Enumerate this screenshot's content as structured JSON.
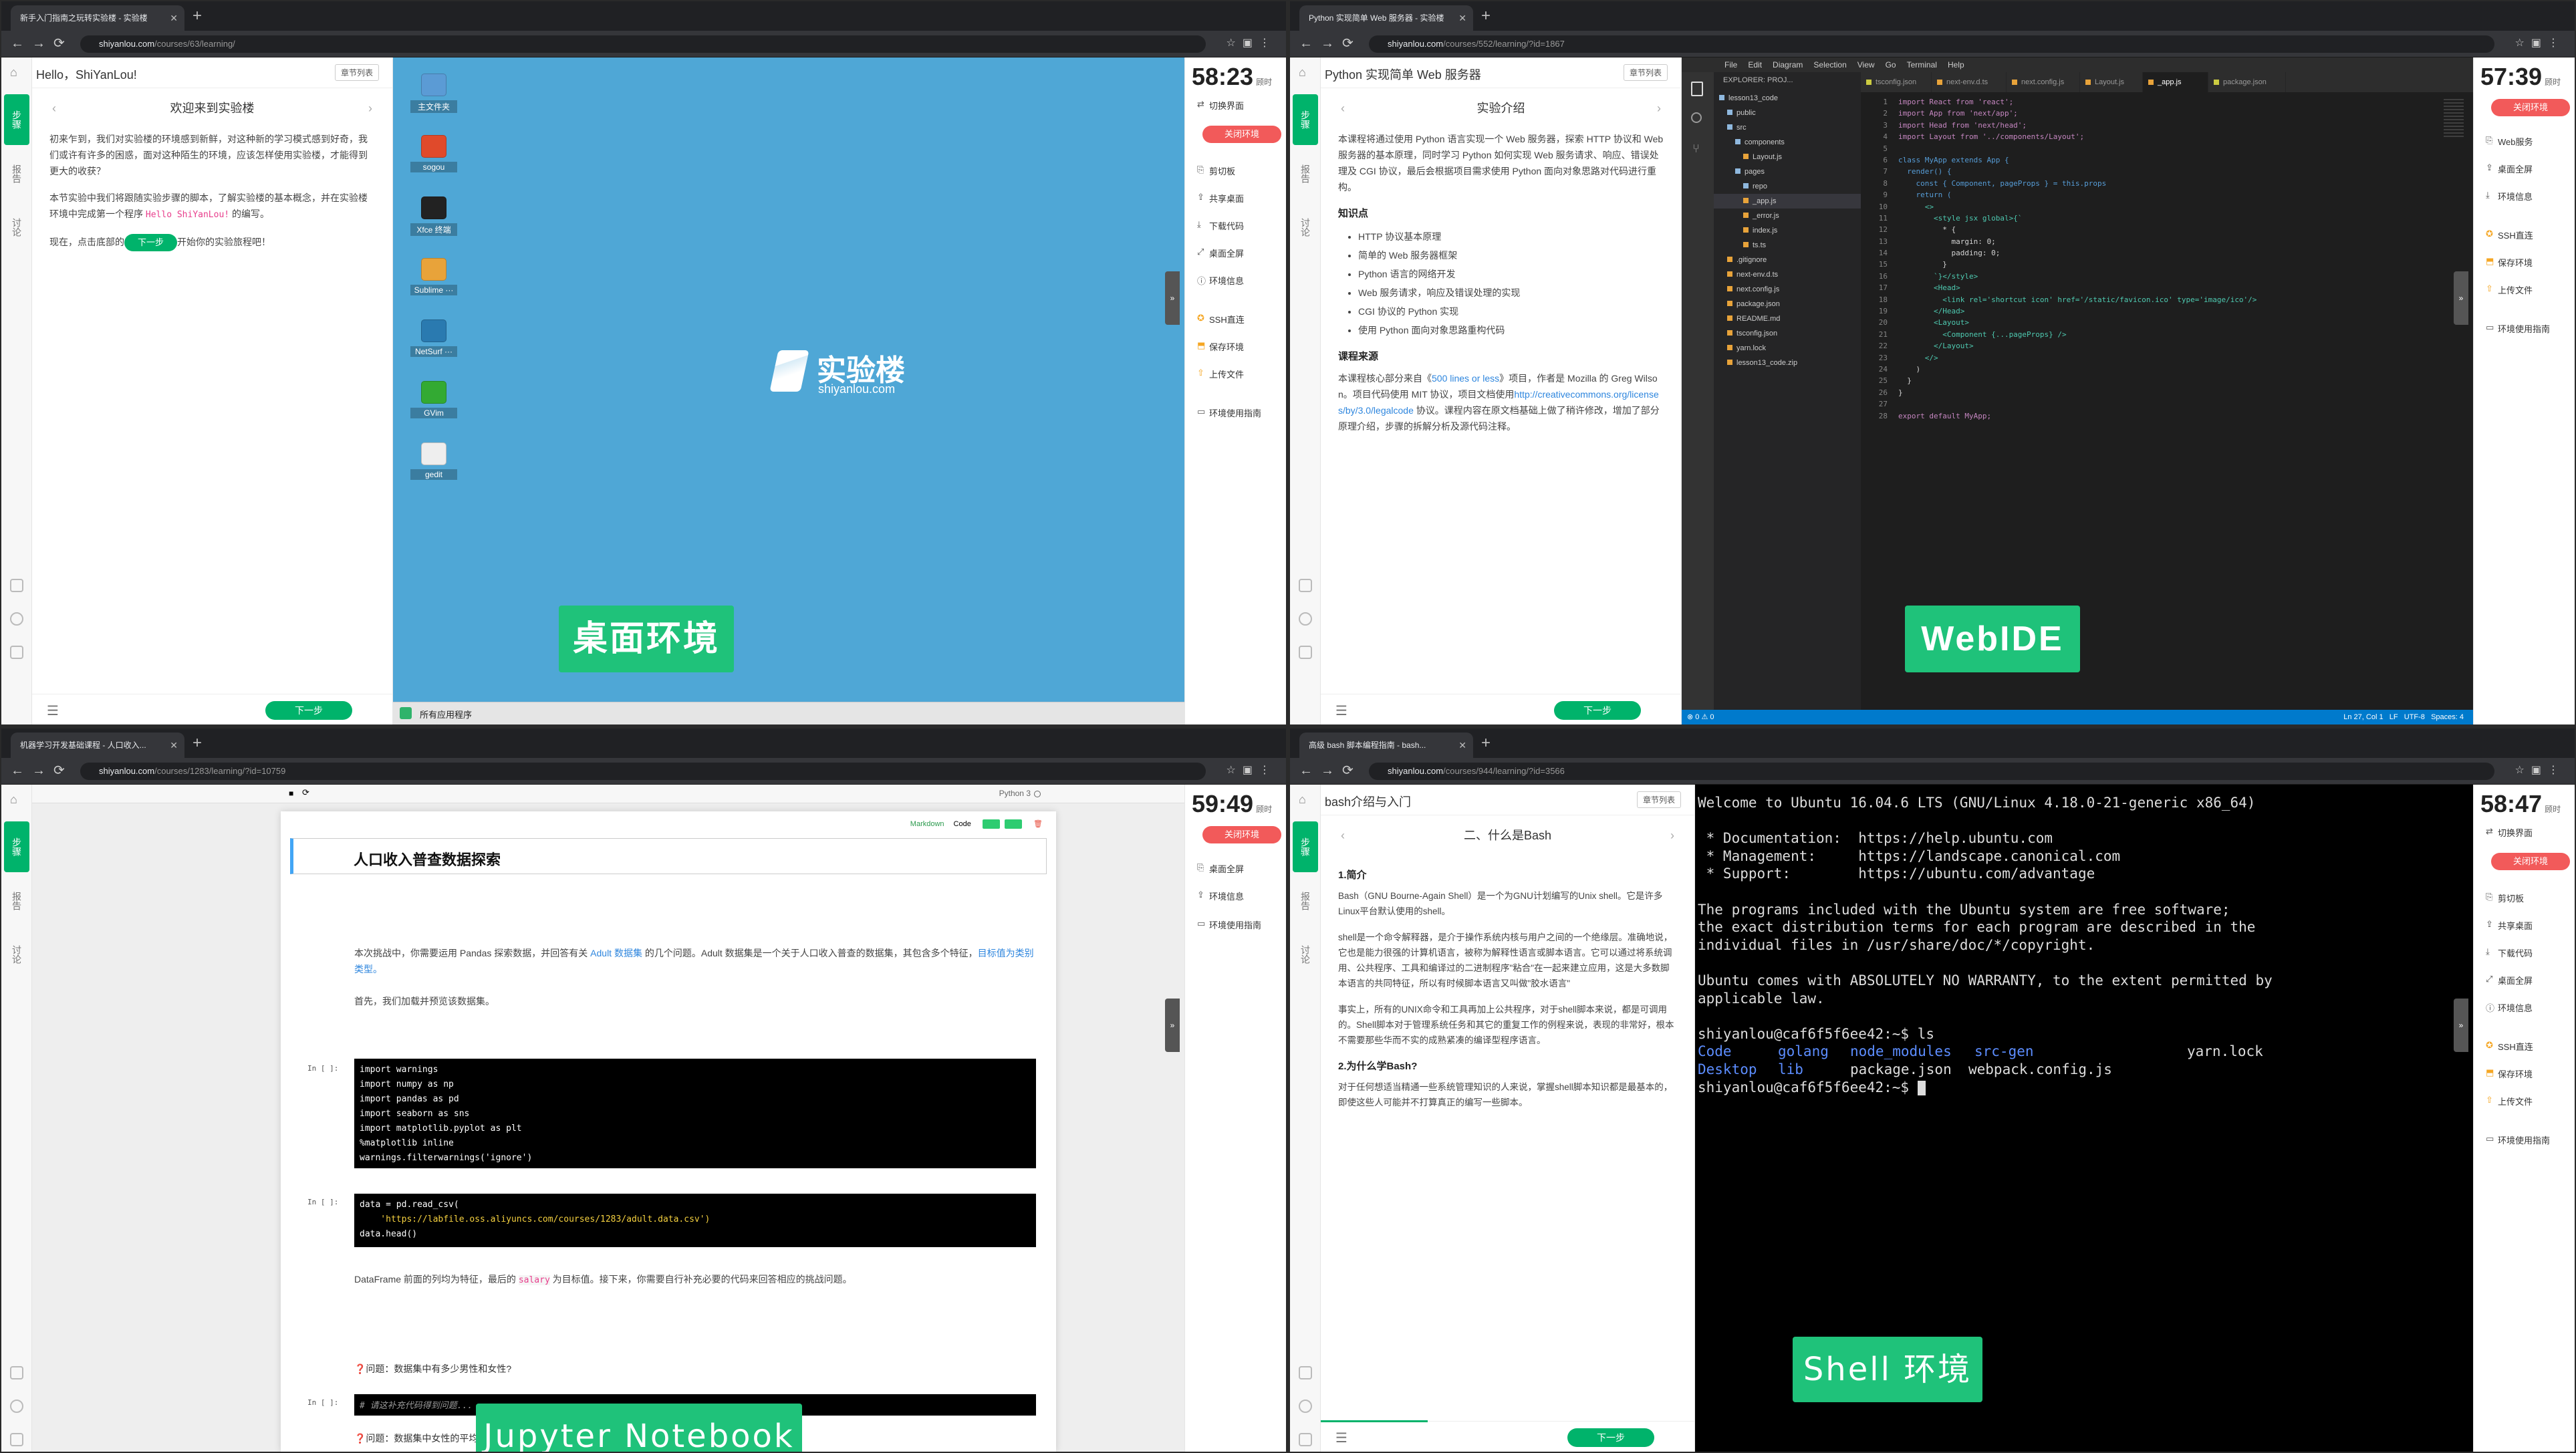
{
  "q1": {
    "tab_title": "新手入门指南之玩转实验楼 - 实验楼",
    "url_domain": "shiyanlou.com",
    "url_path": "/courses/63/learning/",
    "doc_title": "Hello，ShiYanLou!",
    "chapter_btn": "章节列表",
    "sub_title": "欢迎来到实验楼",
    "p1": "初来乍到，我们对实验楼的环境感到新鲜，对这种新的学习模式感到好奇，我们或许有许多的困惑，面对这种陌生的环境，应该怎样使用实验楼，才能得到更大的收获？",
    "p2a": "本节实验中我们将跟随实验步骤的脚本，了解实验楼的基本概念，并在实验楼环境中完成第一个程序 ",
    "p2code": "Hello ShiYanLou!",
    "p2b": " 的编写。",
    "p3a": "现在，点击底部的",
    "p3btn": "下一步",
    "p3b": "开始你的实验旅程吧！",
    "next": "下一步",
    "desktop_icons": [
      "主文件夹",
      "sogou",
      "Xfce 终端",
      "Sublime ···",
      "NetSurf ···",
      "GVim",
      "gedit"
    ],
    "logo_cn": "实验楼",
    "logo_en": "shiyanlou.com",
    "taskbar": "所有应用程序",
    "caption": "桌面环境",
    "timer": "58:23",
    "timer_sub": "顾时",
    "rp_switch": "切换界面",
    "rp_close": "关闭环境",
    "rp_items": [
      "剪切板",
      "共享桌面",
      "下载代码",
      "桌面全屏",
      "环境信息"
    ],
    "rp_items2": [
      "SSH直连",
      "保存环境",
      "上传文件"
    ],
    "rp_guide": "环境使用指南"
  },
  "q2": {
    "tab_title": "Python 实现简单 Web 服务器 - 实验楼",
    "url_domain": "shiyanlou.com",
    "url_path": "/courses/552/learning/?id=1867",
    "doc_title": "Python 实现简单 Web 服务器",
    "chapter_btn": "章节列表",
    "sub_title": "实验介绍",
    "p1": "本课程将通过使用 Python 语言实现一个 Web 服务器，探索 HTTP 协议和 Web 服务器的基本原理，同时学习 Python 如何实现 Web 服务请求、响应、错误处理及 CGI 协议，最后会根据项目需求使用 Python 面向对象思路对代码进行重构。",
    "h_know": "知识点",
    "knowledge": [
      "HTTP 协议基本原理",
      "简单的 Web 服务器框架",
      "Python 语言的网络开发",
      "Web 服务请求，响应及错误处理的实现",
      "CGI 协议的 Python 实现",
      "使用 Python 面向对象思路重构代码"
    ],
    "h_src": "课程来源",
    "src_a": "本课程核心部分来自《",
    "src_link": "500 lines or less",
    "src_b": "》项目，作者是 Mozilla 的 Greg Wilson。项目代码使用 MIT 协议，项目文档使用",
    "src_url": "http://creativecommons.org/licenses/by/3.0/legalcode",
    "src_c": " 协议。课程内容在原文档基础上做了稍许修改，增加了部分原理介绍，步骤的拆解分析及源代码注释。",
    "next": "下一步",
    "menu": [
      "File",
      "Edit",
      "Diagram",
      "Selection",
      "View",
      "Go",
      "Terminal",
      "Help"
    ],
    "explorer_title": "EXPLORER: PROJ...",
    "tabs": [
      "tsconfig.json",
      "next-env.d.ts",
      "next.config.js",
      "Layout.js",
      "_app.js",
      "package.json"
    ],
    "tree": [
      "lesson13_code",
      "public",
      "src",
      "components",
      "Layout.js",
      "pages",
      "repo",
      "_app.js",
      "_error.js",
      "index.js",
      "ts.ts",
      ".gitignore",
      "next-env.d.ts",
      "next.config.js",
      "package.json",
      "README.md",
      "tsconfig.json",
      "yarn.lock",
      "lesson13_code.zip"
    ],
    "code": [
      "import React from 'react';",
      "import App from 'next/app';",
      "import Head from 'next/head';",
      "import Layout from '../components/Layout';",
      "",
      "class MyApp extends App {",
      "  render() {",
      "    const { Component, pageProps } = this.props",
      "    return (",
      "      <>",
      "        <style jsx global>{`",
      "          * {",
      "            margin: 0;",
      "            padding: 0;",
      "          }",
      "        `}</style>",
      "        <Head>",
      "          <link rel='shortcut icon' href='/static/favicon.ico' type='image/ico'/>",
      "        </Head>",
      "        <Layout>",
      "          <Component {...pageProps} />",
      "        </Layout>",
      "      </>",
      "    )",
      "  }",
      "}",
      "",
      "export default MyApp;"
    ],
    "status_left": "⊗ 0 ⚠ 0",
    "status_right": "Ln 27, Col 1   LF   UTF-8   Spaces: 4",
    "caption": "WebIDE",
    "timer": "57:39",
    "timer_sub": "顾时",
    "rp_close": "关闭环境",
    "rp_items": [
      "Web服务",
      "桌面全屏",
      "环境信息"
    ],
    "rp_items2": [
      "SSH直连",
      "保存环境",
      "上传文件"
    ],
    "rp_guide": "环境使用指南"
  },
  "q3": {
    "tab_title": "机器学习开发基础课程 - 人口收入...",
    "url_domain": "shiyanlou.com",
    "url_path": "/courses/1283/learning/?id=10759",
    "kernel": "Python 3",
    "cell_type": "Markdown",
    "cell_code": "Code",
    "nb_title": "人口收入普查数据探索",
    "intro_a": "本次挑战中，你需要运用 Pandas 探索数据，并回答有关 ",
    "intro_link": "Adult 数据集",
    "intro_b": " 的几个问题。Adult 数据集是一个关于人口收入普查的数据集，其包含多个特征，",
    "intro_i": "目标值为类别类型。",
    "intro2": "首先，我们加载并预览该数据集。",
    "prompt": "In [ ]:",
    "cell1": [
      "import warnings",
      "import numpy as np",
      "import pandas as pd",
      "import seaborn as sns",
      "import matplotlib.pyplot as plt",
      "%matplotlib inline",
      "warnings.filterwarnings('ignore')"
    ],
    "cell2": [
      "data = pd.read_csv(",
      "    'https://labfile.oss.aliyuncs.com/courses/1283/adult.data.csv')",
      "data.head()"
    ],
    "df_a": "DataFrame 前面的列均为特征，最后的 ",
    "df_code": "salary",
    "df_b": " 为目标值。接下来，你需要自行补充必要的代码来回答相应的挑战问题。",
    "q1": "❓问题：数据集中有多少男性和女性?",
    "cell3": "# 请这补充代码得到问题...",
    "q2": "❓问题：数据集中女性的平均年龄是多少?",
    "caption": "Jupyter Notebook",
    "timer": "59:49",
    "timer_sub": "顾时",
    "rp_close": "关闭环境",
    "rp_items": [
      "桌面全屏",
      "环境信息"
    ],
    "rp_guide": "环境使用指南"
  },
  "q4": {
    "tab_title": "高级 bash 脚本编程指南 - bash...",
    "url_domain": "shiyanlou.com",
    "url_path": "/courses/944/learning/?id=3566",
    "doc_title": "bash介绍与入门",
    "chapter_btn": "章节列表",
    "sub_title": "二、什么是Bash",
    "h1": "1.简介",
    "p1": "Bash（GNU Bourne-Again Shell）是一个为GNU计划编写的Unix shell。它是许多Linux平台默认使用的shell。",
    "p2": "shell是一个命令解释器，是介于操作系统内核与用户之间的一个绝缘层。准确地说，它也是能力很强的计算机语言，被称为解释性语言或脚本语言。它可以通过将系统调用、公共程序、工具和编译过的二进制程序\"粘合\"在一起来建立应用，这是大多数脚本语言的共同特征，所以有时候脚本语言又叫做\"胶水语言\"",
    "p3": "事实上，所有的UNIX命令和工具再加上公共程序，对于shell脚本来说，都是可调用的。Shell脚本对于管理系统任务和其它的重复工作的例程来说，表现的非常好，根本不需要那些华而不实的成熟紧凑的编译型程序语言。",
    "h2": "2.为什么学Bash?",
    "p4": "对于任何想适当精通一些系统管理知识的人来说，掌握shell脚本知识都是最基本的，即使这些人可能并不打算真正的编写一些脚本。",
    "next": "下一步",
    "term": [
      "Welcome to Ubuntu 16.04.6 LTS (GNU/Linux 4.18.0-21-generic x86_64)",
      "",
      " * Documentation:  https://help.ubuntu.com",
      " * Management:     https://landscape.canonical.com",
      " * Support:        https://ubuntu.com/advantage",
      "",
      "The programs included with the Ubuntu system are free software;",
      "the exact distribution terms for each program are described in the",
      "individual files in /usr/share/doc/*/copyright.",
      "",
      "Ubuntu comes with ABSOLUTELY NO WARRANTY, to the extent permitted by",
      "applicable law.",
      ""
    ],
    "prompt1": "shiyanlou@caf6f5f6ee42:~$ ls",
    "ls1": [
      "Code",
      "golang",
      "node_modules",
      "src-gen"
    ],
    "ls1_file": "yarn.lock",
    "ls2": [
      "Desktop",
      "lib"
    ],
    "ls2_files": "package.json  webpack.config.js",
    "prompt2": "shiyanlou@caf6f5f6ee42:~$ ",
    "caption": "Shell 环境",
    "timer": "58:47",
    "timer_sub": "顾时",
    "rp_switch": "切换界面",
    "rp_close": "关闭环境",
    "rp_items": [
      "剪切板",
      "共享桌面",
      "下载代码",
      "桌面全屏",
      "环境信息"
    ],
    "rp_items2": [
      "SSH直连",
      "保存环境",
      "上传文件"
    ],
    "rp_guide": "环境使用指南"
  },
  "leftnav": {
    "active": "步骤",
    "report": "报告",
    "discuss": "讨论"
  }
}
